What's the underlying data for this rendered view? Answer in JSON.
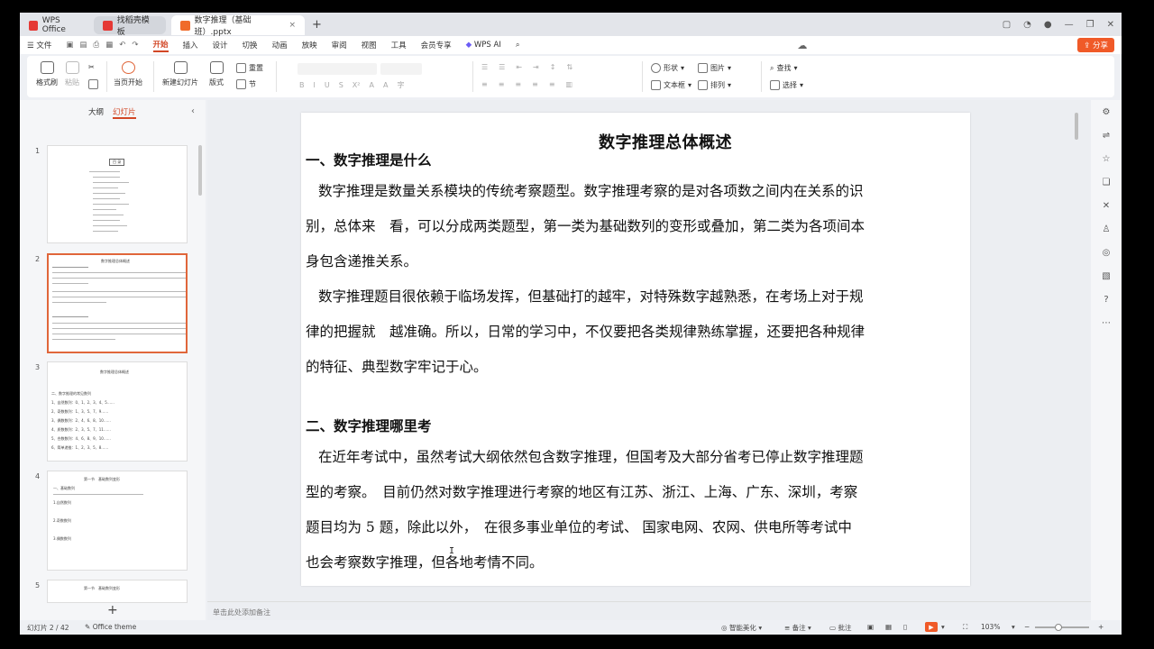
{
  "tabs": {
    "home": "WPS Office",
    "templates": "找稻壳模板",
    "document": "数字推理（基础班）.pptx"
  },
  "menu": {
    "file": "文件",
    "items": [
      "开始",
      "插入",
      "设计",
      "切换",
      "动画",
      "放映",
      "审阅",
      "视图",
      "工具",
      "会员专享"
    ],
    "ai": "WPS AI",
    "share": "分享"
  },
  "ribbon": {
    "format_painter": "格式刷",
    "paste": "粘贴",
    "from_current": "当页开始",
    "new_slide": "新建幻灯片",
    "layout": "版式",
    "reset": "重置",
    "section": "节",
    "shape": "形状",
    "image": "图片",
    "textbox": "文本框",
    "arrange": "排列",
    "find": "查找",
    "select": "选择"
  },
  "left_panel": {
    "outline_tab": "大纲",
    "slides_tab": "幻灯片",
    "slide_numbers": [
      "1",
      "2",
      "3",
      "4",
      "5"
    ],
    "thumb1_title": "目 录",
    "thumb2_title": "数字推理总体概述",
    "thumb3_title": "数字推理总体概述",
    "thumb3_items": [
      "二、数字推理的常见数列",
      "1、自然数列：0、1、2、3、4、5……",
      "2、奇数数列：1、3、5、7、9……",
      "3、偶数数列：2、4、6、8、10……",
      "4、质数数列：2、3、5、7、11……",
      "5、合数数列：4、6、8、9、10……",
      "6、简单递推：1、2、3、5、8……"
    ],
    "thumb4_title": "第一节　基础数列变形",
    "thumb4_items": [
      "一、基础数列",
      "1.自然数列",
      "2.奇数数列",
      "3.偶数数列"
    ],
    "thumb5_title": "第一节　基础数列变形"
  },
  "slide": {
    "title": "数字推理总体概述",
    "heading1": "一、数字推理是什么",
    "para1": [
      "数字推理是数量关系模块的传统考察题型。数字推理考察的是对各项数之间内在关系的识",
      "别，总体来　看，可以分成两类题型，第一类为基础数列的变形或叠加，第二类为各项间本",
      "身包含递推关系。"
    ],
    "para2": [
      "数字推理题目很依赖于临场发挥，但基础打的越牢，对特殊数字越熟悉，在考场上对于规",
      "律的把握就　越准确。所以，日常的学习中，不仅要把各类规律熟练掌握，还要把各种规律",
      "的特征、典型数字牢记于心。"
    ],
    "heading2": "二、数字推理哪里考",
    "para3": [
      "在近年考试中，虽然考试大纲依然包含数字推理，但国考及大部分省考已停止数字推理题",
      "型的考察。　目前仍然对数字推理进行考察的地区有江苏、浙江、上海、广东、深圳，考察",
      "题目均为 5 题，除此以外，　在很多事业单位的考试、 国家电网、农网、供电所等考试中",
      "也会考察数字推理，但各地考情不同。"
    ]
  },
  "notes_placeholder": "单击此处添加备注",
  "status": {
    "slide_counter": "幻灯片 2 / 42",
    "theme": "Office theme",
    "beautify": "智能美化",
    "notes": "备注",
    "comments": "批注",
    "zoom": "103%"
  },
  "colors": {
    "accent": "#d24726",
    "share": "#f05a28"
  }
}
